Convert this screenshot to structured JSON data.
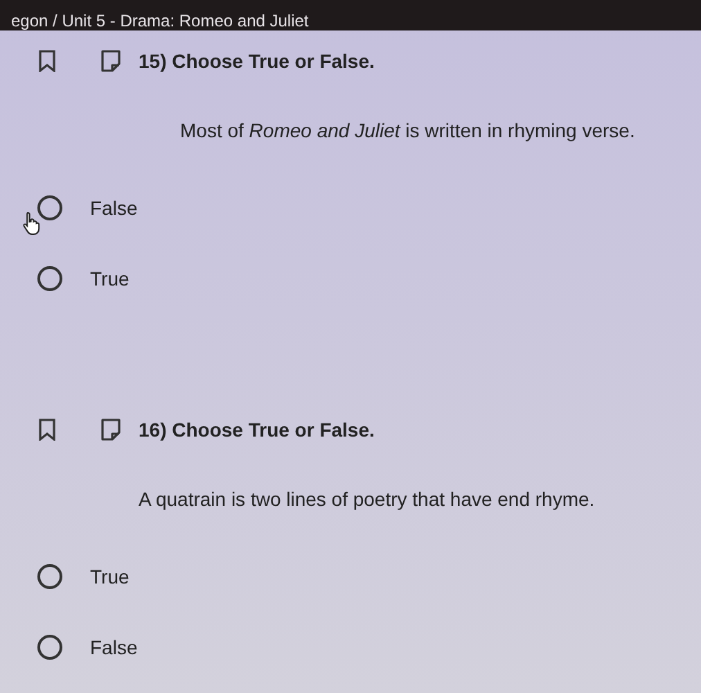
{
  "breadcrumb": "egon / Unit 5 - Drama: Romeo and Juliet",
  "questions": [
    {
      "title": "15) Choose True or False.",
      "statement": "Most of *Romeo and Juliet* is written in rhyming verse.",
      "options": [
        {
          "label": "False",
          "selected": false
        },
        {
          "label": "True",
          "selected": false
        }
      ]
    },
    {
      "title": "16) Choose True or False.",
      "statement": "A quatrain is two lines of poetry that have end rhyme.",
      "options": [
        {
          "label": "True",
          "selected": false
        },
        {
          "label": "False",
          "selected": false
        }
      ]
    }
  ]
}
